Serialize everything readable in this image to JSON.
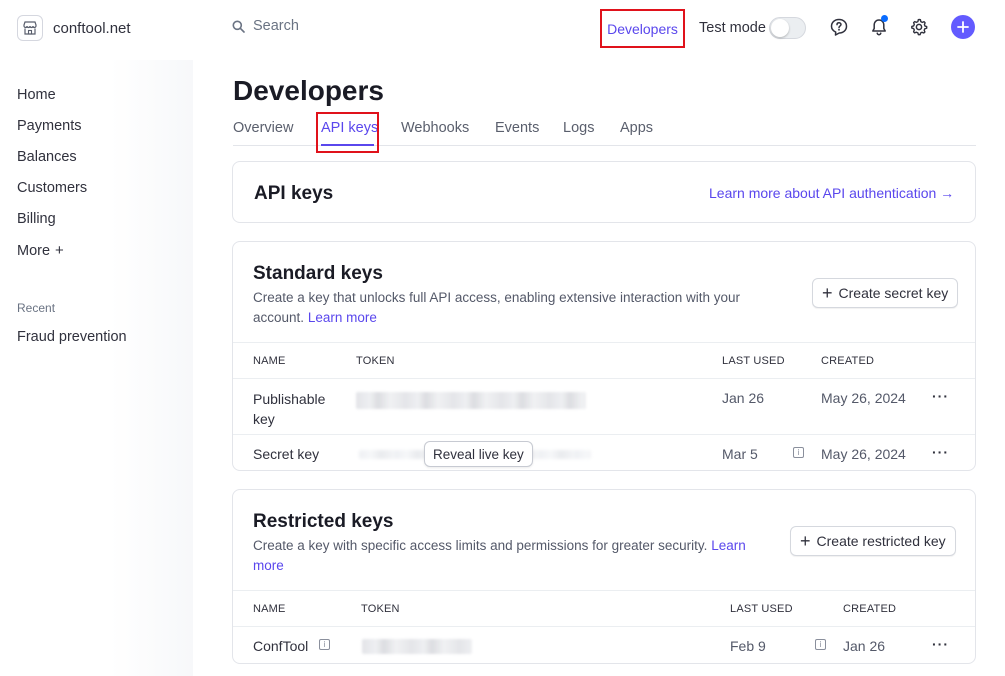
{
  "brand": {
    "name": "conftool.net"
  },
  "sidebar": {
    "items": [
      {
        "label": "Home"
      },
      {
        "label": "Payments"
      },
      {
        "label": "Balances"
      },
      {
        "label": "Customers"
      },
      {
        "label": "Billing"
      },
      {
        "label": "More",
        "suffix": "+"
      }
    ],
    "recent_label": "Recent",
    "recent_items": [
      {
        "label": "Fraud prevention"
      }
    ]
  },
  "topbar": {
    "search_placeholder": "Search",
    "developers_label": "Developers",
    "test_mode_label": "Test mode",
    "test_mode_on": false,
    "icons": [
      "help-icon",
      "bell-icon",
      "gear-icon",
      "plus-icon"
    ],
    "accent_color": "#635bff"
  },
  "page": {
    "title": "Developers",
    "tabs": [
      {
        "label": "Overview"
      },
      {
        "label": "API keys",
        "active": true
      },
      {
        "label": "Webhooks"
      },
      {
        "label": "Events"
      },
      {
        "label": "Logs"
      },
      {
        "label": "Apps"
      }
    ]
  },
  "api_keys_card": {
    "title": "API keys",
    "learn_more": "Learn more about API authentication",
    "arrow": "→"
  },
  "standard_keys": {
    "title": "Standard keys",
    "description": "Create a key that unlocks full API access, enabling extensive interaction with your account.",
    "learn_more": "Learn more",
    "create_button": "Create secret key",
    "columns": {
      "name": "NAME",
      "token": "TOKEN",
      "last_used": "LAST USED",
      "created": "CREATED"
    },
    "rows": [
      {
        "name_line1": "Publishable",
        "name_line2": "key",
        "last_used": "Jan 26",
        "created": "May 26, 2024",
        "menu": "···"
      },
      {
        "name": "Secret key",
        "reveal_label": "Reveal live key",
        "last_used": "Mar 5",
        "created": "May 26, 2024",
        "menu": "···"
      }
    ]
  },
  "restricted_keys": {
    "title": "Restricted keys",
    "description": "Create a key with specific access limits and permissions for greater security.",
    "learn_more_1": "Learn",
    "learn_more_2": "more",
    "create_button": "Create restricted key",
    "columns": {
      "name": "NAME",
      "token": "TOKEN",
      "last_used": "LAST USED",
      "created": "CREATED"
    },
    "rows": [
      {
        "name": "ConfTool",
        "last_used": "Feb 9",
        "created": "Jan 26",
        "menu": "···"
      }
    ]
  },
  "colors": {
    "link": "#5a47ed",
    "highlight_border": "#e0121b",
    "text": "#30313d"
  }
}
